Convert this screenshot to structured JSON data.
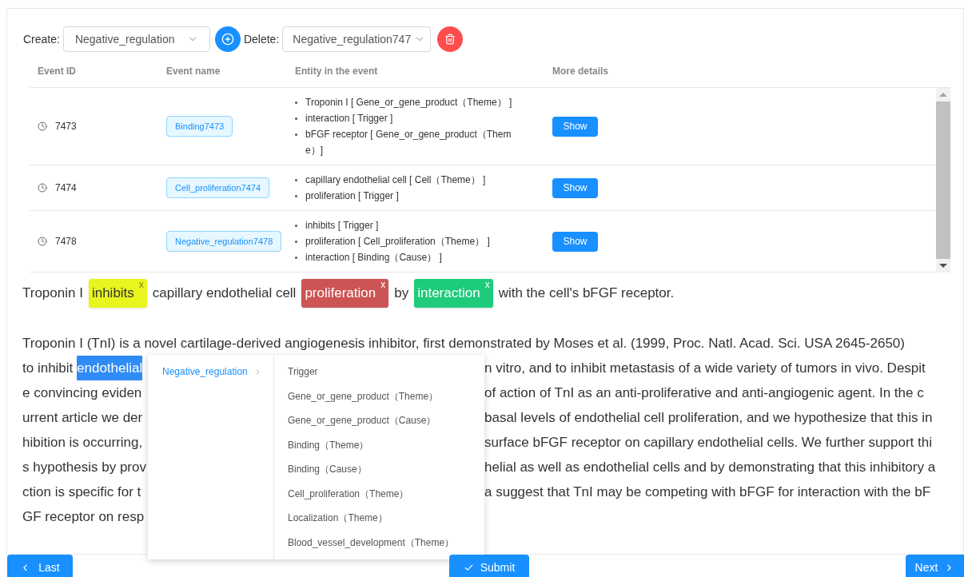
{
  "toolbar": {
    "create_label": "Create:",
    "create_value": "Negative_regulation",
    "delete_label": "Delete:",
    "delete_value": "Negative_regulation747"
  },
  "table": {
    "columns": [
      "Event ID",
      "Event name",
      "Entity in the event",
      "More details"
    ],
    "rows": [
      {
        "id": "7473",
        "name": "Binding7473",
        "entities": [
          "Troponin I [ Gene_or_gene_product（Theme） ]",
          "interaction [ Trigger ]",
          "bFGF receptor [ Gene_or_gene_product（Theme）]"
        ],
        "action": "Show"
      },
      {
        "id": "7474",
        "name": "Cell_proliferation7474",
        "entities": [
          "capillary endothelial cell [ Cell（Theme） ]",
          "proliferation [ Trigger ]"
        ],
        "action": "Show"
      },
      {
        "id": "7478",
        "name": "Negative_regulation7478",
        "entities": [
          "inhibits [ Trigger ]",
          "proliferation [ Cell_proliferation（Theme） ]",
          "interaction [ Binding（Cause） ]"
        ],
        "action": "Show"
      }
    ]
  },
  "sentence": [
    {
      "kind": "plain",
      "text": "Troponin I"
    },
    {
      "kind": "entity",
      "text": "inhibits",
      "color": "#e8f51e",
      "remove": "x"
    },
    {
      "kind": "plain",
      "text": "capillary endothelial cell"
    },
    {
      "kind": "entity",
      "text": "proliferation",
      "color": "#cd5454",
      "remove": "x"
    },
    {
      "kind": "plain",
      "text": "by"
    },
    {
      "kind": "entity",
      "text": "interaction",
      "color": "#1dcb7b",
      "remove": "x"
    },
    {
      "kind": "plain",
      "text": "with the cell's bFGF receptor."
    }
  ],
  "paragraph": [
    {
      "left": "Troponin I (TnI) is a novel cartilage-derived angiogenesis inhibitor, first demonstrated by Moses et al. (1999, Proc. Natl. Acad. Sci. USA 2645-2650)"
    },
    {
      "left": "to inhibit ",
      "selected_text": "endothelial",
      "right": "n vitro, and to inhibit metastasis of a wide variety of tumors in vivo. Despit"
    },
    {
      "left": "e convincing eviden",
      "right": "of action of TnI as an anti-proliferative and anti-angiogenic agent. In the c"
    },
    {
      "left": "urrent article we der",
      "right": "basal levels of endothelial cell proliferation, and we hypothesize that this in"
    },
    {
      "left": "hibition is occurring,",
      "right": "surface bFGF receptor on capillary endothelial cells. We further support thi"
    },
    {
      "left": "s hypothesis by prov",
      "right": "helial as well as endothelial cells and by demonstrating that this inhibitory a"
    },
    {
      "left": "ction is specific for t",
      "right": "a suggest that TnI may be competing with bFGF for interaction with the bF"
    },
    {
      "left": "GF receptor on resp"
    }
  ],
  "menu": {
    "parent": "Negative_regulation",
    "items": [
      "Trigger",
      "Gene_or_gene_product（Theme）",
      "Gene_or_gene_product（Cause）",
      "Binding（Theme）",
      "Binding（Cause）",
      "Cell_proliferation（Theme）",
      "Localization（Theme）",
      "Blood_vessel_development（Theme）"
    ]
  },
  "footer": {
    "last": "Last",
    "submit": "Submit",
    "next": "Next"
  }
}
